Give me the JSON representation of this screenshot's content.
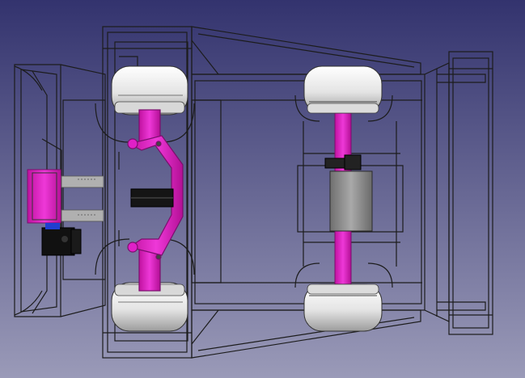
{
  "viewport": {
    "background_top": "#33336e",
    "background_bottom": "#9a9ab8"
  },
  "colors": {
    "wireframe": "#1c1c1c",
    "magenta_part": "#e020c8",
    "magenta_edge": "#7a0f6d",
    "wheel_light": "#f2f2f2",
    "wheel_shade": "#a8a8a8",
    "motor_grey": "#8e8e8e",
    "servo_black": "#111111",
    "servo_blue": "#1f3fd0",
    "bracket_grey": "#b0b0b0"
  },
  "model": {
    "parts": [
      "chassis-frame",
      "front-left-wheel",
      "front-right-wheel",
      "rear-left-wheel",
      "rear-right-wheel",
      "steering-linkage",
      "rear-axle",
      "drive-motor",
      "steering-servo",
      "servo-mount",
      "rear-bumper"
    ]
  }
}
